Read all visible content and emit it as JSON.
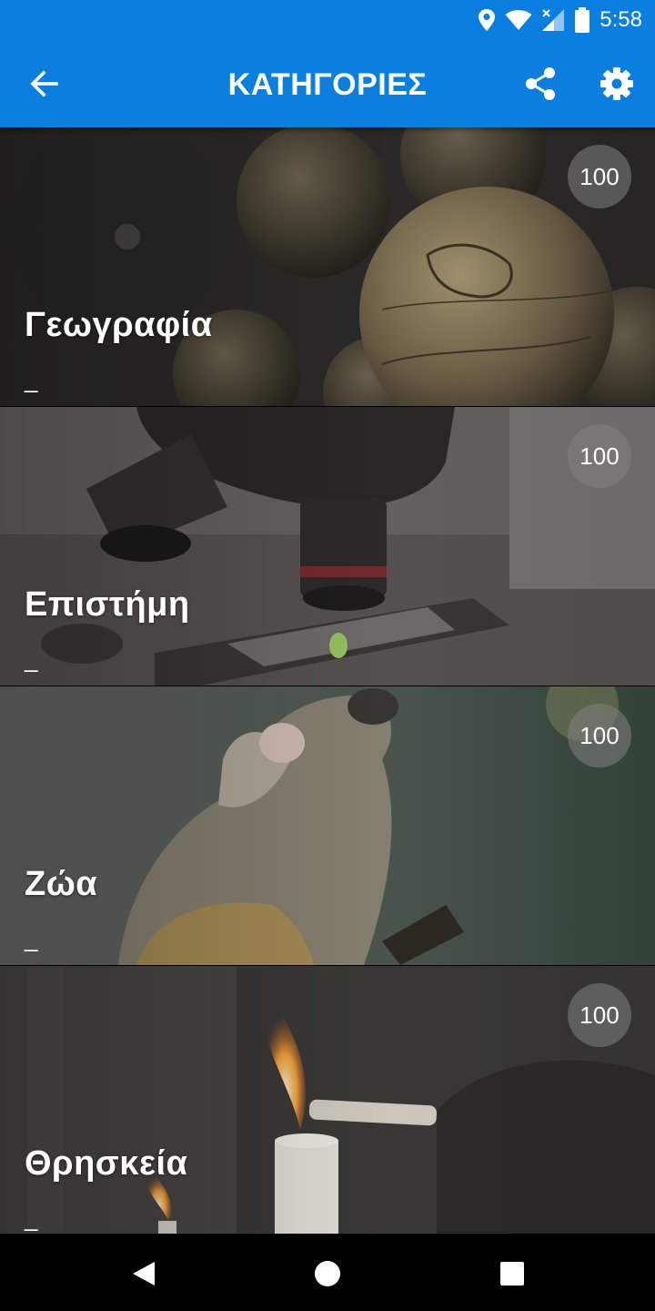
{
  "status_bar": {
    "time": "5:58",
    "icons": [
      "location-icon",
      "wifi-icon",
      "signal-icon",
      "battery-icon"
    ]
  },
  "app_bar": {
    "title": "ΚΑΤΗΓΟΡΙΕΣ",
    "background": "#0A7FE0",
    "actions": [
      "back-arrow-icon",
      "share-icon",
      "settings-gear-icon"
    ]
  },
  "categories": [
    {
      "name": "Γεωγραφία",
      "subtitle": "_",
      "count": "100"
    },
    {
      "name": "Επιστήμη",
      "subtitle": "_",
      "count": "100"
    },
    {
      "name": "Ζώα",
      "subtitle": "_",
      "count": "100"
    },
    {
      "name": "Θρησκεία",
      "subtitle": "_",
      "count": "100"
    }
  ],
  "nav_bar": {
    "buttons": [
      "back-triangle-icon",
      "home-circle-icon",
      "recents-square-icon"
    ]
  }
}
